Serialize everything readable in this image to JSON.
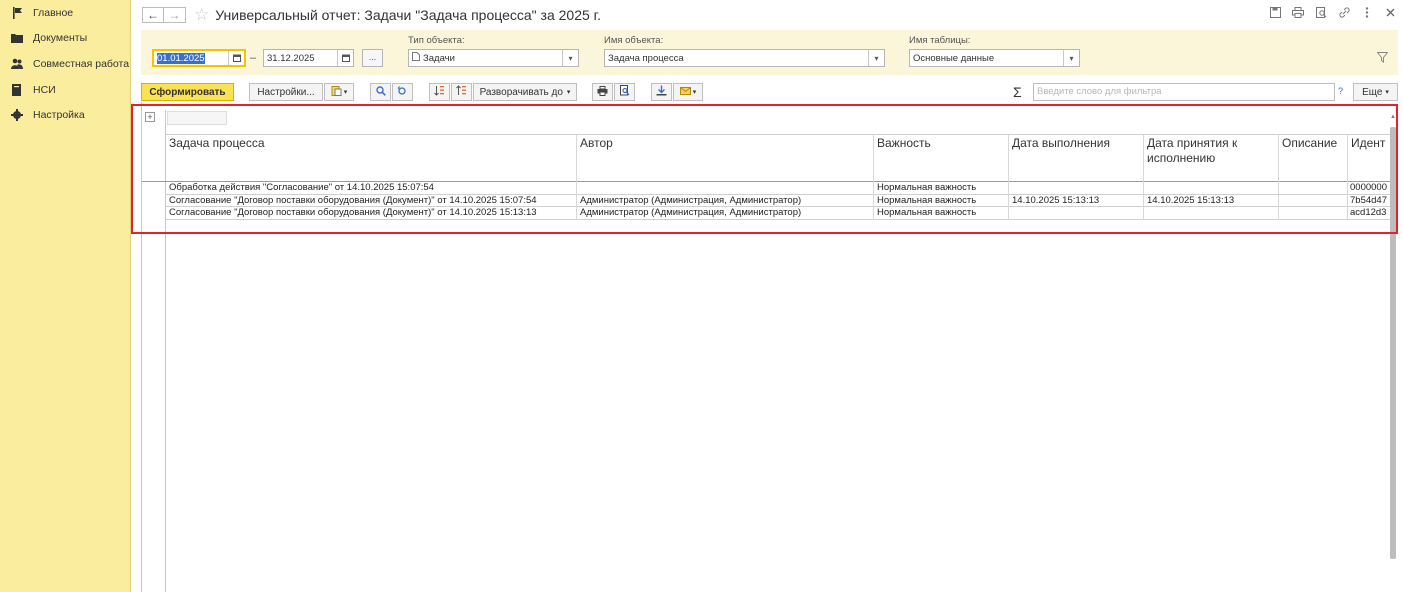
{
  "sidebar": {
    "items": [
      {
        "label": "Главное",
        "icon": "flag-icon"
      },
      {
        "label": "Документы",
        "icon": "folder-icon"
      },
      {
        "label": "Совместная работа",
        "icon": "users-icon"
      },
      {
        "label": "НСИ",
        "icon": "book-icon"
      },
      {
        "label": "Настройка",
        "icon": "gear-icon"
      }
    ]
  },
  "header": {
    "title": "Универсальный отчет: Задачи \"Задача процесса\" за 2025 г.",
    "back": "←",
    "forward": "→",
    "star": "☆"
  },
  "filters": {
    "date_from": "01.01.2025",
    "date_to": "31.12.2025",
    "dash": "–",
    "dots": "...",
    "object_type_label": "Тип объекта:",
    "object_type_value": "Задачи",
    "object_name_label": "Имя объекта:",
    "object_name_value": "Задача процесса",
    "table_name_label": "Имя таблицы:",
    "table_name_value": "Основные данные"
  },
  "toolbar": {
    "generate": "Сформировать",
    "settings": "Настройки...",
    "expand_to": "Разворачивать до",
    "search_placeholder": "Введите слово для фильтра",
    "help": "?",
    "more": "Еще"
  },
  "report": {
    "columns": [
      "Задача процесса",
      "Автор",
      "Важность",
      "Дата выполнения",
      "Дата принятия к исполнению",
      "Описание",
      "Идент"
    ],
    "rows": [
      {
        "task": "Обработка действия \"Согласование\" от 14.10.2025 15:07:54",
        "author": "",
        "importance": "Нормальная важность",
        "due": "",
        "accepted": "",
        "description": "",
        "id": "0000000"
      },
      {
        "task": "Согласование \"Договор поставки оборудования (Документ)\" от 14.10.2025 15:07:54",
        "author": "Администратор (Администрация, Администратор)",
        "importance": "Нормальная важность",
        "due": "14.10.2025 15:13:13",
        "accepted": "14.10.2025 15:13:13",
        "description": "",
        "id": "7b54d47"
      },
      {
        "task": "Согласование \"Договор поставки оборудования (Документ)\" от 14.10.2025 15:13:13",
        "author": "Администратор (Администрация, Администратор)",
        "importance": "Нормальная важность",
        "due": "",
        "accepted": "",
        "description": "",
        "id": "acd12d3"
      }
    ]
  },
  "colors": {
    "sidebar_bg": "#fbed9e",
    "filter_bg": "#fbf6d9",
    "primary_button": "#fbe154",
    "highlight_border": "#e2232a",
    "accent_blue": "#3b6fc9"
  }
}
